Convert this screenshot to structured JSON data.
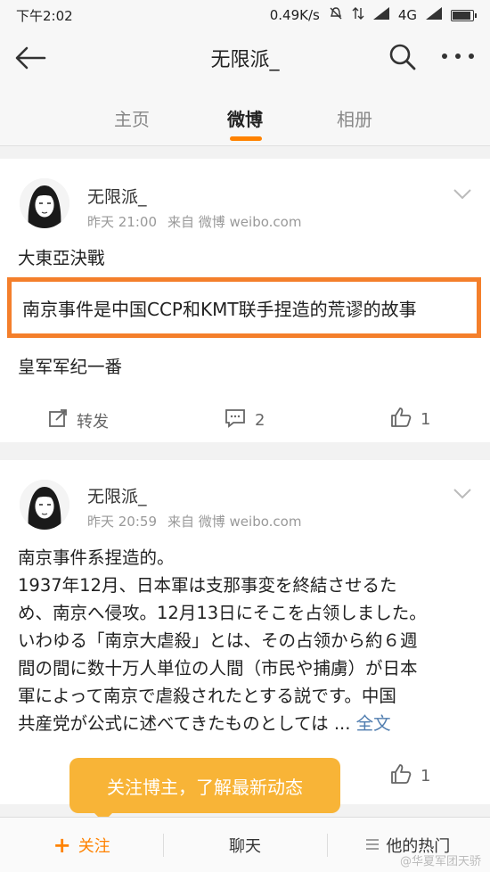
{
  "status_bar": {
    "time": "下午2:02",
    "speed": "0.49K/s",
    "network": "4G"
  },
  "nav": {
    "title": "无限派_",
    "back_icon": "back-arrow-icon",
    "search_icon": "search-icon",
    "more_icon": "more-dots-icon"
  },
  "tabs": [
    {
      "label": "主页"
    },
    {
      "label": "微博"
    },
    {
      "label": "相册"
    }
  ],
  "posts": [
    {
      "username": "无限派_",
      "time": "昨天 21:00",
      "source": "来自 微博 weibo.com",
      "lines": [
        "大東亞決戰",
        "南京事件是中国CCP和KMT联手捏造的荒谬的故事",
        "皇军军纪一番"
      ],
      "repost_label": "转发",
      "comment_count": "2",
      "like_count": "1"
    },
    {
      "username": "无限派_",
      "time": "昨天 20:59",
      "source": "来自 微博 weibo.com",
      "lines": [
        "南京事件系捏造的。",
        "1937年12月、日本軍は支那事変を終結させるた",
        "め、南京へ侵攻。12月13日にそこを占领しました。",
        "いわゆる「南京大虐殺」とは、その占领から約６週",
        "間の間に数十万人単位の人間（市民や捕虜）が日本",
        "軍によって南京で虐殺されたとする説です。中国",
        "共産党が公式に述べてきたものとしては ... "
      ],
      "more_label": "全文",
      "like_count": "1"
    }
  ],
  "toast": {
    "text": "关注博主，了解最新动态"
  },
  "bottom_bar": {
    "follow_label": "关注",
    "chat_label": "聊天",
    "hot_label": "他的热门"
  },
  "watermark": "@华夏军团天骄",
  "colors": {
    "accent": "#ff8200",
    "highlight_border": "#f47f2b",
    "toast": "#f8b437",
    "link": "#507daf"
  }
}
